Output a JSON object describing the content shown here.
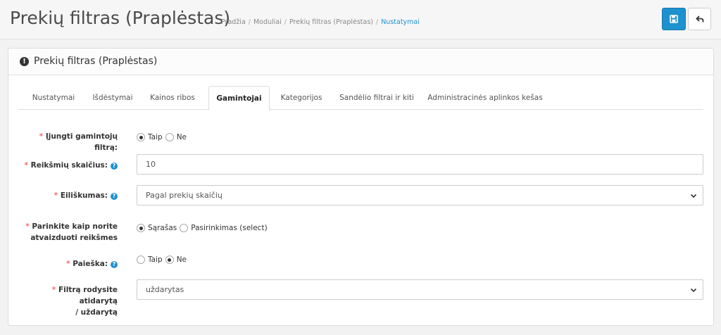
{
  "header": {
    "title": "Prekių filtras (Praplėstas)",
    "breadcrumbs": [
      "Pradžia",
      "Moduliai",
      "Prekių filtras (Praplėstas)",
      "Nustatymai"
    ],
    "save_icon": "save-icon",
    "back_icon": "back-arrow-icon",
    "accent_color": "#1e91cf"
  },
  "panel": {
    "title": "Prekių filtras (Praplėstas)",
    "icon": "exclamation-circle-icon"
  },
  "tabs": [
    "Nustatymai",
    "Išdėstymai",
    "Kainos ribos",
    "Gamintojai",
    "Kategorijos",
    "Sandėlio filtrai ir kiti",
    "Administracinės aplinkos kešas"
  ],
  "active_tab": "Gamintojai",
  "form": {
    "enable": {
      "label": "Įjungti gamintojų filtrą:",
      "opt1": "Taip",
      "opt2": "Ne",
      "selected": "Taip"
    },
    "count": {
      "label": "Reikšmių skaičius:",
      "value": "10"
    },
    "order": {
      "label": "Eiliškumas:",
      "value": "Pagal prekių skaičių"
    },
    "display": {
      "label_line1": "Parinkite kaip norite",
      "label_line2": "atvaizduoti reikšmes",
      "opt1": "Sąrašas",
      "opt2": "Pasirinkimas (select)",
      "selected": "Sąrašas"
    },
    "search": {
      "label": "Paieška:",
      "opt1": "Taip",
      "opt2": "Ne",
      "selected": "Ne"
    },
    "open": {
      "label_line1": "Filtrą rodysite atidarytą",
      "label_line2": "/ uždarytą",
      "value": "uždarytas"
    }
  }
}
